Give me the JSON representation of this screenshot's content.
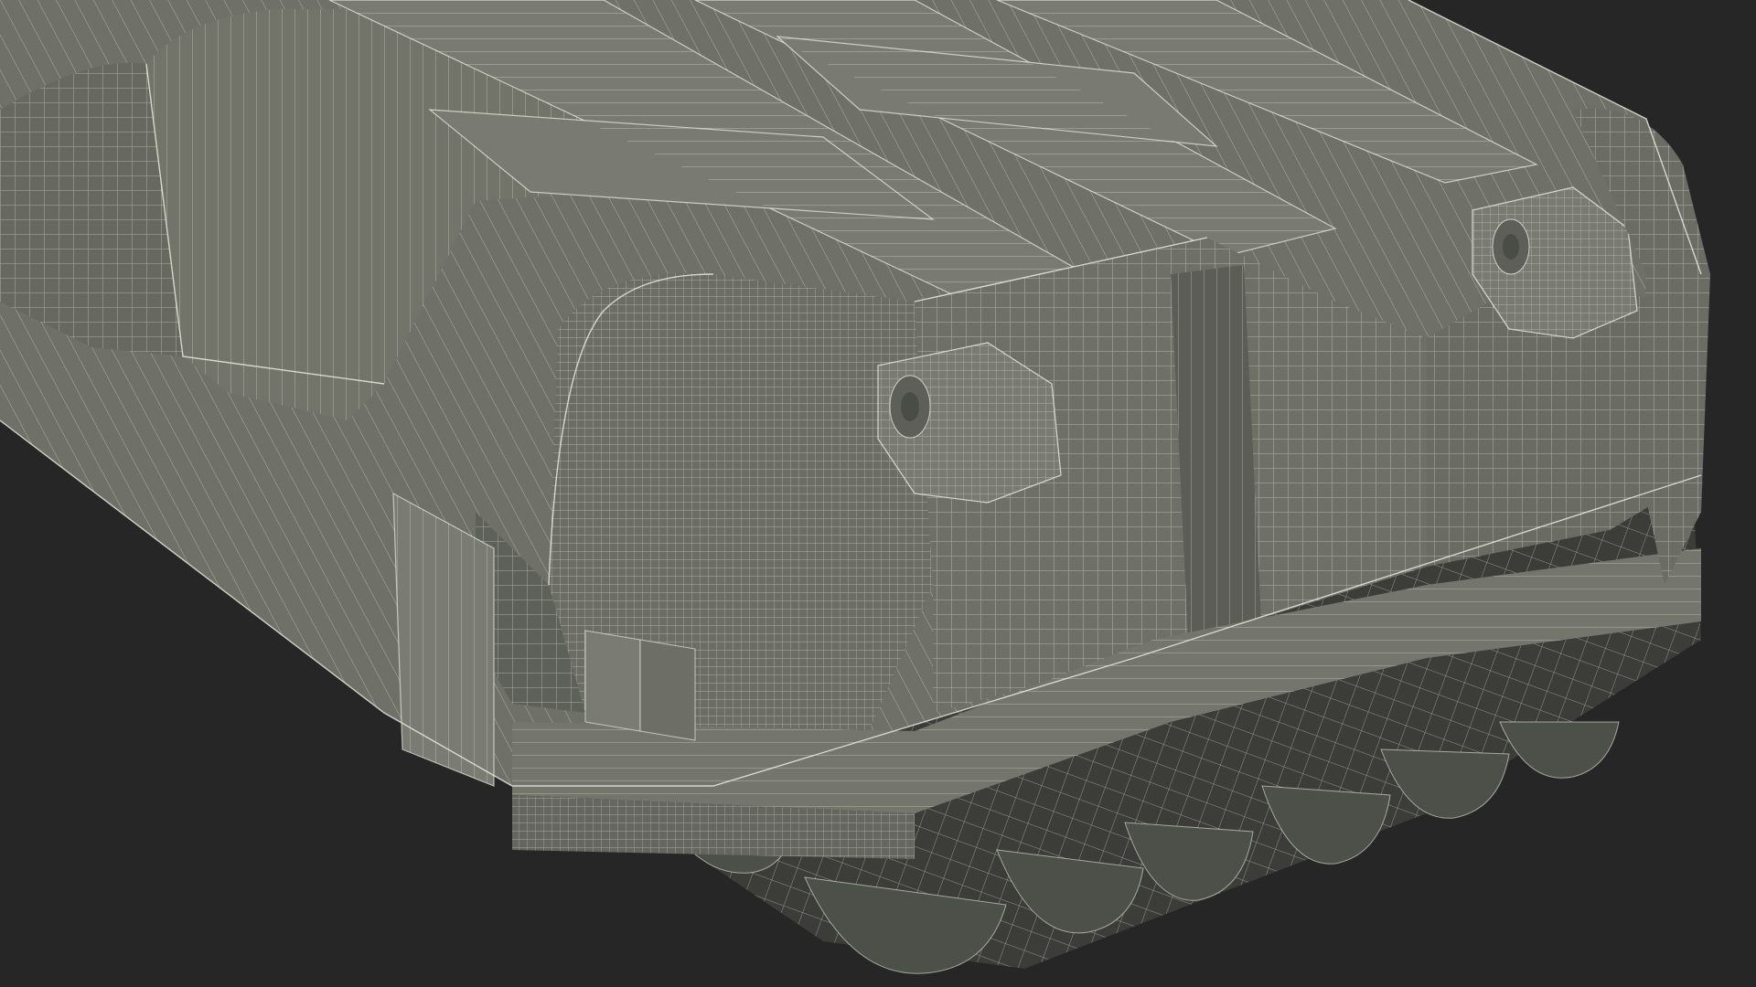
{
  "scene": {
    "subject": "wireframe-hard-case-3d-model",
    "background_color": "#262626",
    "shell_color": "#6f7169",
    "shell_light_color": "#7c7e75",
    "shell_dark_color": "#585a53",
    "shadow_color": "#3c3d39",
    "wire_color": "#e9e9dc"
  }
}
